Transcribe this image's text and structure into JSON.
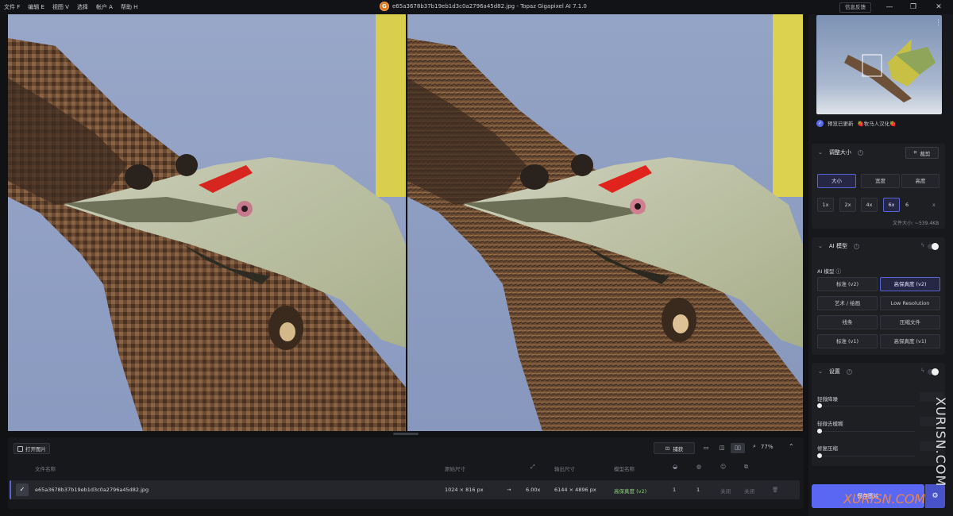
{
  "menu": [
    {
      "label": "文件 F"
    },
    {
      "label": "编辑 E"
    },
    {
      "label": "视图 V"
    },
    {
      "label": "选择"
    },
    {
      "label": "帐户 A"
    },
    {
      "label": "帮助 H"
    }
  ],
  "window": {
    "title": "e65a3678b37b19eb1d3c0a2796a45d82.jpg - Topaz Gigapixel AI 7.1.0",
    "logo_letter": "G",
    "feedback_label": "信息反馈",
    "minimize": "—",
    "restore": "❐",
    "close": "✕"
  },
  "navigator": {
    "kebab": "⋮",
    "preview_check": "✓",
    "preview_updated_label": "预览已更新",
    "credit_label": "🍓牧马人汉化🍓"
  },
  "resize_section": {
    "title": "调整大小",
    "crop_label": "裁剪",
    "tabs": [
      {
        "label": "大小"
      },
      {
        "label": "宽度"
      },
      {
        "label": "高度"
      }
    ],
    "scales": [
      {
        "label": "1x"
      },
      {
        "label": "2x"
      },
      {
        "label": "4x"
      },
      {
        "label": "6x"
      }
    ],
    "custom_value": "6",
    "custom_unit": "x",
    "file_size": "文件大小: ~539.4KB"
  },
  "ai_model_section": {
    "title": "AI 模型",
    "subtitle": "AI 模型 ⓘ",
    "models": [
      {
        "label": "标准 (v2)"
      },
      {
        "label": "高保真度 (v2)"
      },
      {
        "label": "艺术 / 绘画"
      },
      {
        "label": "Low Resolution"
      },
      {
        "label": "线条"
      },
      {
        "label": "压缩文件"
      },
      {
        "label": "标准 (v1)"
      },
      {
        "label": "高保真度 (v1)"
      }
    ],
    "selected_index": 1
  },
  "settings_section": {
    "title": "设置",
    "sliders": [
      {
        "label": "轻微降噪",
        "value": 0
      },
      {
        "label": "轻微去模糊",
        "value": 0
      },
      {
        "label": "修复压缩",
        "value": 0
      }
    ]
  },
  "export_label": "保存图片",
  "toolbar": {
    "open_label": "打开图片",
    "capture_label": "捕获",
    "zoom_value": "77%",
    "views": [
      {
        "glyph": "▭"
      },
      {
        "glyph": "◫"
      },
      {
        "glyph": "▯▯"
      }
    ]
  },
  "table": {
    "headers": {
      "name": "文件名称",
      "original_size": "原始尺寸",
      "output_size": "输出尺寸",
      "model_name": "模型名称"
    },
    "header_icons": {
      "scale": "⤢",
      "denoise": "◒",
      "deblur": "◍",
      "face": "☺",
      "recover": "⧉"
    },
    "rows": [
      {
        "check": "✓",
        "filename": "e65a3678b37b19eb1d3c0a2796a45d82.jpg",
        "original_size": "1024 × 816 px",
        "arrow": "→",
        "scale": "6.00x",
        "output_size": "6144 × 4896 px",
        "model": "高保真度 (v2)",
        "v1": "1",
        "v2": "1",
        "v3": "关闭",
        "v4": "关闭",
        "delete_icon": "🗑"
      }
    ]
  },
  "watermark": {
    "vertical": "XURISN.COM",
    "horizontal": "XURISN.COM"
  },
  "colors": {
    "accent": "#5a67f2",
    "bg": "#111214",
    "panel": "#1d1f23",
    "green": "#8ed07a"
  }
}
